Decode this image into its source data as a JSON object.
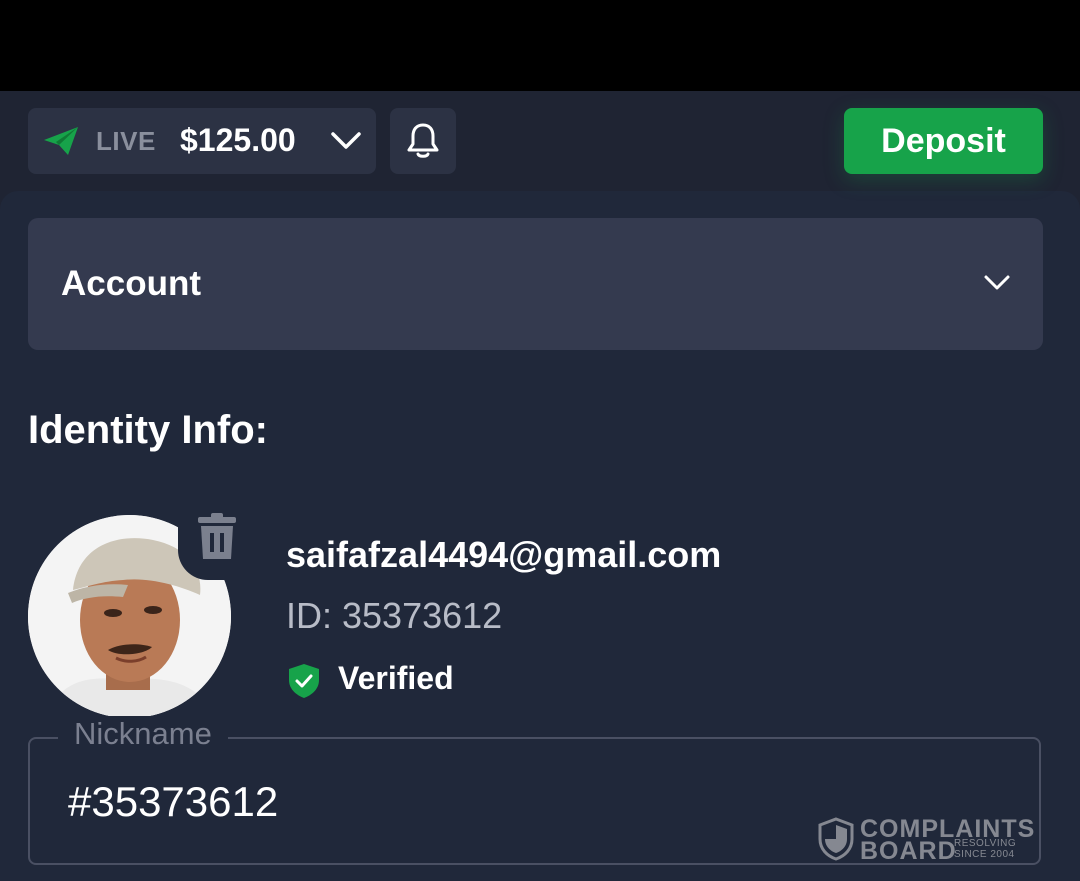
{
  "topbar": {
    "account_type": "LIVE",
    "balance": "$125.00",
    "deposit_label": "Deposit"
  },
  "account_section": {
    "label": "Account"
  },
  "identity": {
    "title": "Identity Info:",
    "email": "saifafzal4494@gmail.com",
    "id_text": "ID: 35373612",
    "verified_label": "Verified"
  },
  "nickname": {
    "legend": "Nickname",
    "value": "#35373612"
  },
  "watermark": {
    "line1": "COMPLAINTS",
    "line2": "BOARD",
    "line3": "RESOLVING SINCE 2004"
  },
  "icons": {
    "account_chip": "paper-plane-icon",
    "dropdown": "chevron-down-icon",
    "notifications": "bell-icon",
    "delete_avatar": "trash-icon",
    "verified": "shield-check-icon"
  },
  "colors": {
    "accent_green": "#17a34a",
    "background": "#1f2433",
    "panel": "#20283a",
    "card": "#343a4f"
  }
}
